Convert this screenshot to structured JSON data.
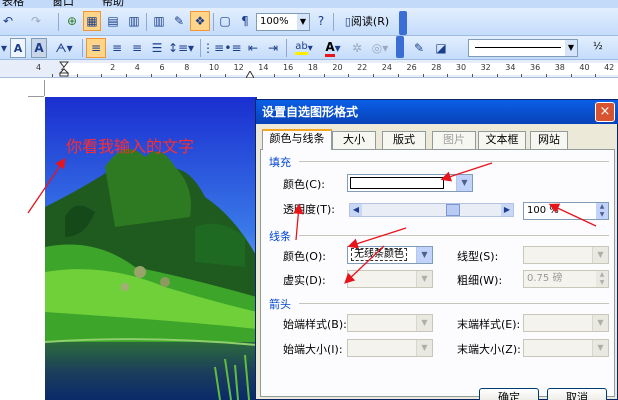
{
  "menu": {
    "items": [
      "表格",
      "窗口",
      "帮助"
    ]
  },
  "toolbar": {
    "zoom": "100%",
    "read_label": "阅读",
    "read_shortcut": "(R)",
    "lowercase_a": "A",
    "uppercase_a": "A",
    "font_color_a": "A",
    "highlight_ab": "ab",
    "font_size_value": "½"
  },
  "ruler": {
    "numbers": [
      "4",
      "2",
      "",
      "2",
      "4",
      "6",
      "8",
      "10",
      "12",
      "14",
      "16",
      "18",
      "20",
      "22",
      "24",
      "26",
      "28",
      "30",
      "32",
      "34",
      "36",
      "38",
      "40",
      "42",
      "44",
      "46",
      "48"
    ]
  },
  "document": {
    "overlay_text": "你看我输入的文字"
  },
  "dialog": {
    "title": "设置自选图形格式",
    "close": "×",
    "tabs": [
      {
        "label": "颜色与线条"
      },
      {
        "label": "大小"
      },
      {
        "label": "版式"
      },
      {
        "label": "图片"
      },
      {
        "label": "文本框"
      },
      {
        "label": "网站"
      }
    ],
    "fill_section": "填充",
    "fill_color_label": "颜色(C):",
    "fill_color_value": "",
    "transparency_label": "透明度(T):",
    "transparency_value": "100 %",
    "line_section": "线条",
    "line_color_label": "颜色(O):",
    "line_color_value": "无线条颜色",
    "line_style_label": "线型(S):",
    "line_style_value": "",
    "dash_label": "虚实(D):",
    "dash_value": "",
    "weight_label": "粗细(W):",
    "weight_value": "0.75 磅",
    "arrows_section": "箭头",
    "begin_style_label": "始端样式(B):",
    "end_style_label": "末端样式(E):",
    "begin_size_label": "始端大小(I):",
    "end_size_label": "末端大小(Z):",
    "ok_button": "确定",
    "cancel_button": "取消"
  },
  "colors": {
    "accent_red": "#e8141c",
    "title_blue": "#0a5fe6",
    "section_blue": "#0046d5"
  }
}
